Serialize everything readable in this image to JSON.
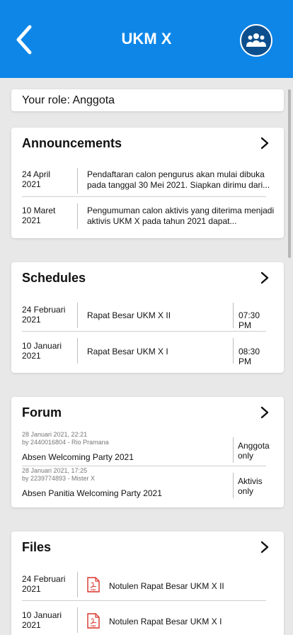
{
  "header": {
    "title": "UKM X",
    "back_icon": "chevron-left-icon",
    "members_icon": "group-icon"
  },
  "role": {
    "text": "Your role: Anggota"
  },
  "announcements": {
    "title": "Announcements",
    "items": [
      {
        "date": "24 April 2021",
        "text": "Pendaftaran calon pengurus akan mulai dibuka pada tanggal 30 Mei 2021. Siapkan dirimu dari..."
      },
      {
        "date": "10 Maret 2021",
        "text": "Pengumuman calon aktivis yang diterima menjadi aktivis UKM X pada tahun 2021 dapat..."
      }
    ]
  },
  "schedules": {
    "title": "Schedules",
    "items": [
      {
        "date": "24 Februari 2021",
        "event": "Rapat Besar UKM X II",
        "time": "07:30 PM"
      },
      {
        "date": "10 Januari 2021",
        "event": "Rapat Besar UKM X I",
        "time": "08:30 PM"
      }
    ]
  },
  "forum": {
    "title": "Forum",
    "items": [
      {
        "timestamp": "28 Januari 2021, 22:21",
        "author": "by 2440016804 - Rio Pramana",
        "topic": "Absen Welcoming Party 2021",
        "access": "Anggota only"
      },
      {
        "timestamp": "28 Januari 2021, 17:25",
        "author": "by 2239774893 - Mister X",
        "topic": "Absen Panitia Welcoming Party 2021",
        "access": "Aktivis only"
      }
    ]
  },
  "files": {
    "title": "Files",
    "items": [
      {
        "date": "24 Februari 2021",
        "name": "Notulen Rapat Besar UKM X II",
        "icon": "pdf-file-icon",
        "icon_text": "PDF"
      },
      {
        "date": "10 Januari 2021",
        "name": "Notulen Rapat Besar UKM X I",
        "icon": "pdf-file-icon",
        "icon_text": "PDF"
      }
    ]
  },
  "colors": {
    "header": "#0d86e8",
    "members_button": "#0c4f8e",
    "background": "#e8e8e8",
    "pdf_red": "#d9342b"
  }
}
